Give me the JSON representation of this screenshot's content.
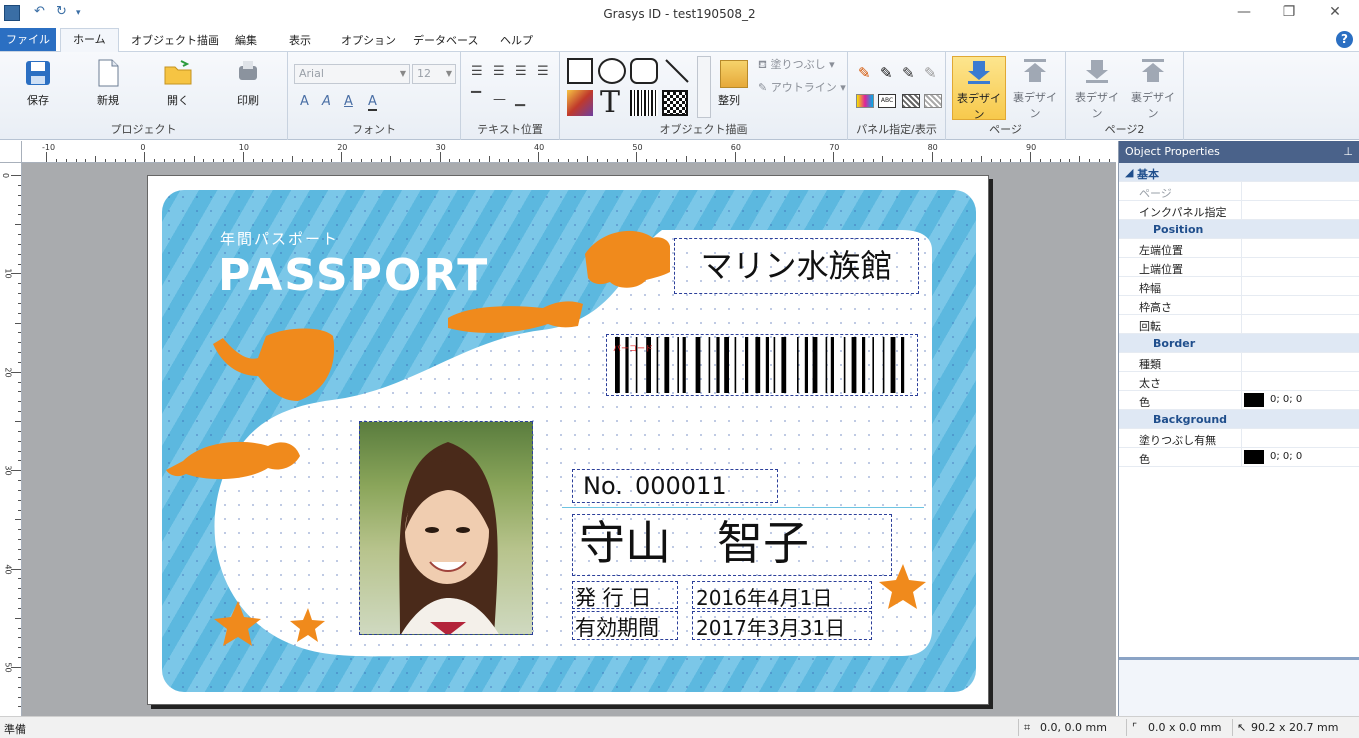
{
  "window": {
    "title": "Grasys ID - test190508_2"
  },
  "menu": {
    "file": "ファイル",
    "tabs": [
      "ホーム",
      "オブジェクト描画",
      "編集",
      "表示",
      "オプション",
      "データベース",
      "ヘルプ"
    ]
  },
  "ribbon": {
    "project": {
      "label": "プロジェクト",
      "save": "保存",
      "new": "新規",
      "open": "開く",
      "print": "印刷"
    },
    "font": {
      "label": "フォント",
      "family": "Arial",
      "size": "12"
    },
    "text_position": {
      "label": "テキスト位置"
    },
    "object_draw": {
      "label": "オブジェクト描画",
      "fill": "塗りつぶし",
      "outline": "アウトライン",
      "align": "整列"
    },
    "panel": {
      "label": "パネル指定/表示"
    },
    "page": {
      "label": "ページ",
      "front": "表デザイン",
      "back": "裏デザイン"
    },
    "page2": {
      "label": "ページ2",
      "front": "表デザイン",
      "back": "裏デザイン"
    }
  },
  "ruler": {
    "h_labels": [
      "-10",
      "0",
      "10",
      "20",
      "30",
      "40",
      "50",
      "60",
      "70",
      "80",
      "90"
    ],
    "v_labels": [
      "0",
      "10",
      "20",
      "30",
      "40",
      "50"
    ]
  },
  "card": {
    "subtitle": "年間パスポート",
    "title": "PASSPORT",
    "aquarium": "マリン水族館",
    "no_label": "No.",
    "number": "000011",
    "name": "守山　智子",
    "issue_label": "発 行 日",
    "issue_date": "2016年4月1日",
    "valid_label": "有効期間",
    "valid_date": "2017年3月31日",
    "barcode_marker": "バーコード"
  },
  "properties": {
    "title": "Object Properties",
    "basic": "基本",
    "page": "ページ",
    "ink_panel": "インクパネル指定",
    "position": "Position",
    "left": "左端位置",
    "top": "上端位置",
    "width": "枠幅",
    "height": "枠高さ",
    "rotation": "回転",
    "border": "Border",
    "type": "種類",
    "thickness": "太さ",
    "color": "色",
    "border_color_value": "0; 0; 0",
    "background": "Background",
    "fill_enabled": "塗りつぶし有無",
    "bg_color": "色",
    "bg_color_value": "0; 0; 0"
  },
  "status": {
    "ready": "準備",
    "position": "0.0, 0.0 mm",
    "size": "0.0 x 0.0 mm",
    "object_size": "90.2 x 20.7 mm"
  },
  "colors": {
    "accent": "#2b6fc2",
    "card_blue": "#5cb8df",
    "fish_orange": "#f08a1c",
    "selected": "#f7c94c"
  }
}
